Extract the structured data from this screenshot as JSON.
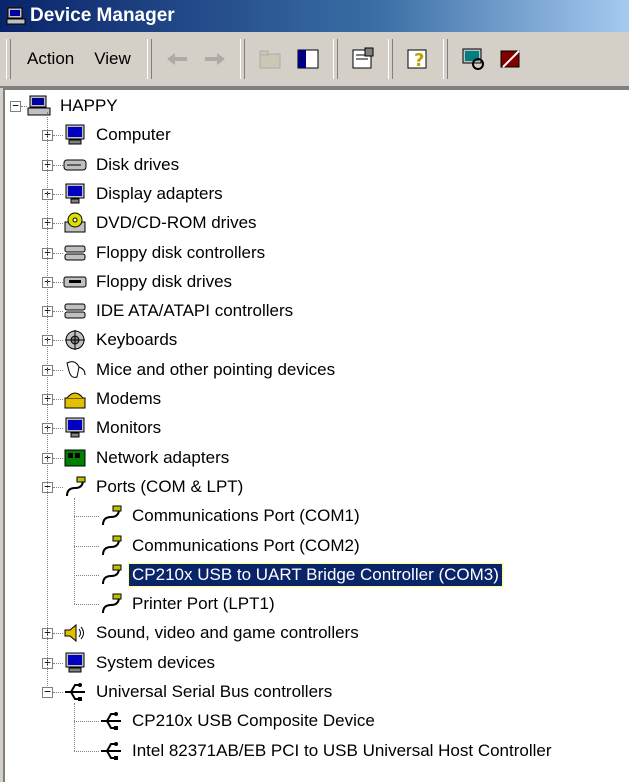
{
  "window": {
    "title": "Device Manager"
  },
  "menu": {
    "action": "Action",
    "view": "View"
  },
  "toolbar": {
    "icons": [
      "back-arrow-icon",
      "forward-arrow-icon",
      "up-folder-icon",
      "show-hide-tree-icon",
      "properties-icon",
      "help-icon",
      "scan-hardware-icon",
      "uninstall-icon"
    ]
  },
  "tree": {
    "root": {
      "label": "HAPPY"
    },
    "categories": [
      {
        "label": "Computer",
        "icon": "computer-icon"
      },
      {
        "label": "Disk drives",
        "icon": "disk-drive-icon"
      },
      {
        "label": "Display adapters",
        "icon": "display-icon"
      },
      {
        "label": "DVD/CD-ROM drives",
        "icon": "cdrom-icon"
      },
      {
        "label": "Floppy disk controllers",
        "icon": "controller-icon"
      },
      {
        "label": "Floppy disk drives",
        "icon": "floppy-drive-icon"
      },
      {
        "label": "IDE ATA/ATAPI controllers",
        "icon": "controller-icon"
      },
      {
        "label": "Keyboards",
        "icon": "keyboard-icon"
      },
      {
        "label": "Mice and other pointing devices",
        "icon": "mouse-icon"
      },
      {
        "label": "Modems",
        "icon": "modem-icon"
      },
      {
        "label": "Monitors",
        "icon": "monitor-icon"
      },
      {
        "label": "Network adapters",
        "icon": "network-adapter-icon"
      },
      {
        "label": "Ports (COM & LPT)",
        "icon": "port-icon",
        "expanded": true,
        "children": [
          {
            "label": "Communications Port (COM1)"
          },
          {
            "label": "Communications Port (COM2)"
          },
          {
            "label": "CP210x USB to UART Bridge Controller (COM3)",
            "selected": true
          },
          {
            "label": "Printer Port (LPT1)"
          }
        ]
      },
      {
        "label": "Sound, video and game controllers",
        "icon": "speaker-icon"
      },
      {
        "label": "System devices",
        "icon": "computer-icon"
      },
      {
        "label": "Universal Serial Bus controllers",
        "icon": "usb-icon",
        "expanded": true,
        "children": [
          {
            "label": "CP210x USB Composite Device"
          },
          {
            "label": "Intel 82371AB/EB PCI to USB Universal Host Controller"
          }
        ]
      }
    ]
  },
  "colors": {
    "selection": "#0a246a",
    "title_gradient_start": "#0a246a",
    "title_gradient_end": "#a6caf0"
  }
}
